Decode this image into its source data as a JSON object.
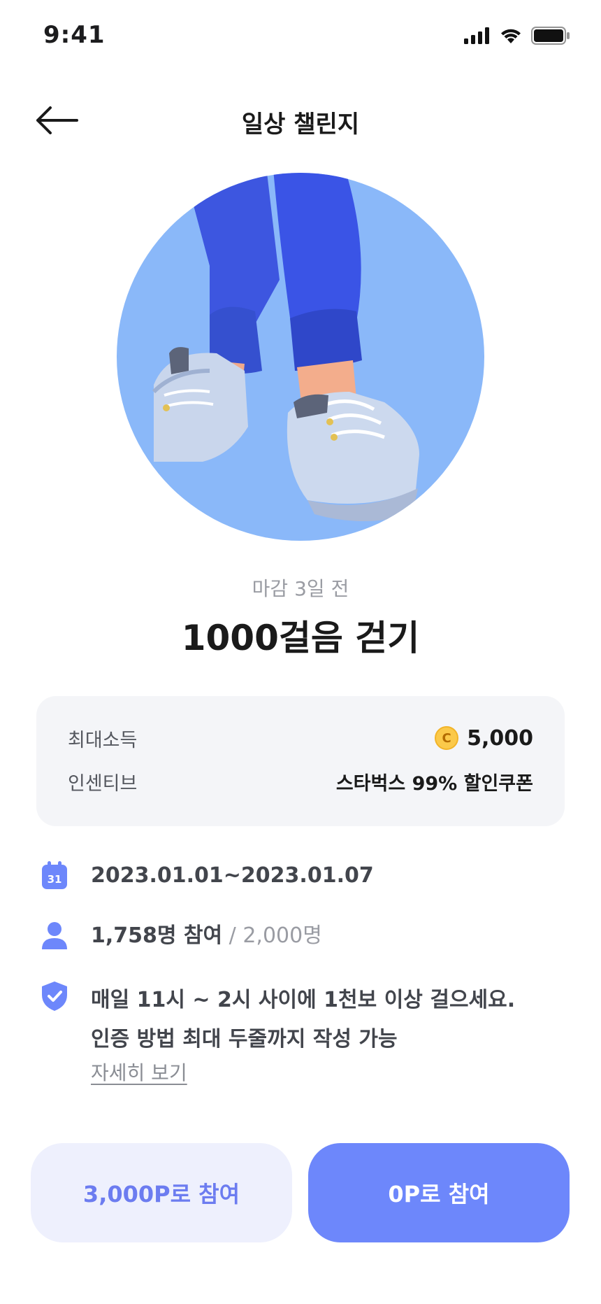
{
  "status_bar": {
    "time": "9:41"
  },
  "header": {
    "title": "일상 챌린지"
  },
  "challenge": {
    "deadline": "마감 3일 전",
    "title": "1000걸음 걷기"
  },
  "rewards": {
    "max_income_label": "최대소득",
    "coin_symbol": "C",
    "max_income_value": "5,000",
    "incentive_label": "인센티브",
    "incentive_value": "스타벅스 99% 할인쿠폰"
  },
  "details": {
    "calendar_day": "31",
    "period": "2023.01.01~2023.01.07",
    "participants": "1,758명 참여",
    "capacity": " / 2,000명",
    "rule_line1": "매일 11시 ~ 2시 사이에 1천보 이상 걸으세요.",
    "rule_line2": "인증 방법 최대 두줄까지 작성 가능",
    "more_link": "자세히 보기"
  },
  "actions": {
    "join_points": "3,000P로 참여",
    "join_free": "0P로 참여"
  },
  "colors": {
    "accent": "#6d87fb",
    "accent_light": "#eef0fd",
    "hero_circle": "#8ab8f9",
    "coin": "#fbc94a"
  },
  "icons": {
    "back": "arrow-left-icon",
    "calendar": "calendar-icon",
    "person": "person-icon",
    "shield": "shield-check-icon"
  }
}
